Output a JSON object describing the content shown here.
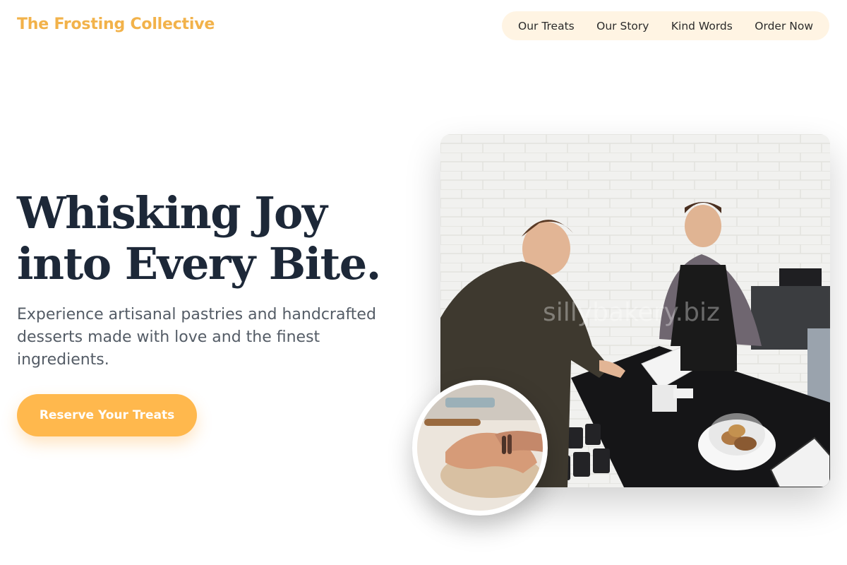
{
  "brand": {
    "name": "The Frosting Collective"
  },
  "nav": {
    "items": [
      {
        "label": "Our Treats"
      },
      {
        "label": "Our Story"
      },
      {
        "label": "Kind Words"
      },
      {
        "label": "Order Now"
      }
    ]
  },
  "hero": {
    "headline_line1": "Whisking Joy",
    "headline_line2": "into Every Bite.",
    "subtext": "Experience artisanal pastries and handcrafted desserts made with love and the finest ingredients.",
    "cta_label": "Reserve Your Treats"
  },
  "images": {
    "main_watermark": "sillybakery.biz"
  },
  "colors": {
    "accent": "#ffb84d",
    "brand_text": "#f2b24a",
    "nav_background": "#fff4e3",
    "headline": "#1d2838",
    "body_text": "#545c66"
  }
}
